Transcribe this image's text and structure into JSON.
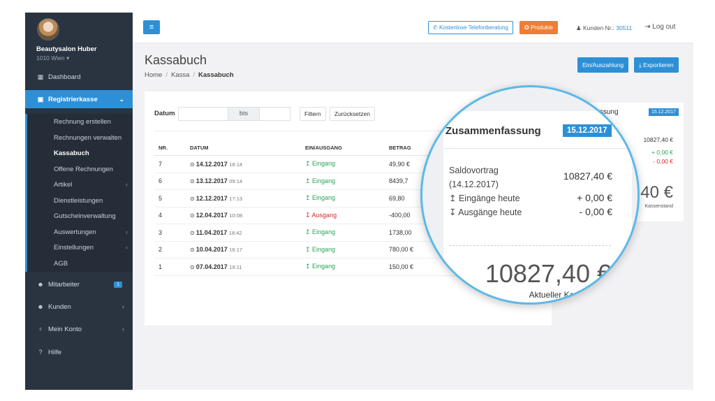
{
  "sidebar": {
    "business_name": "Beautysalon Huber",
    "business_city": "1010 Wien ▾",
    "items": [
      {
        "label": "Dashboard",
        "icon": "grid-icon"
      },
      {
        "label": "Registrierkasse",
        "icon": "cash-register-icon"
      },
      {
        "label": "Mitarbeiter",
        "icon": "users-icon",
        "badge": "1"
      },
      {
        "label": "Kunden",
        "icon": "users-icon"
      },
      {
        "label": "Mein Konto",
        "icon": "bulb-icon"
      },
      {
        "label": "Hilfe",
        "icon": "question-icon"
      }
    ],
    "sub_items": [
      {
        "label": "Rechnung erstellen"
      },
      {
        "label": "Rechnungen verwalten"
      },
      {
        "label": "Kassabuch"
      },
      {
        "label": "Offene Rechnungen"
      },
      {
        "label": "Artikel"
      },
      {
        "label": "Dienstleistungen"
      },
      {
        "label": "Gutscheinverwaltung"
      },
      {
        "label": "Auswertungen"
      },
      {
        "label": "Einstellungen"
      },
      {
        "label": "AGB"
      }
    ]
  },
  "topbar": {
    "menu_icon": "≡",
    "phone_label": "Kostenlose Telefonberatung",
    "products_label": "Produkte",
    "customer_label": "Kunden Nr.:",
    "customer_number": "30511",
    "logout_label": "Log out"
  },
  "page": {
    "title": "Kassabuch",
    "breadcrumb": [
      "Home",
      "Kassa",
      "Kassabuch"
    ],
    "btn_ein_aus": "Ein/Auszahlung",
    "btn_export": "Exportieren"
  },
  "filter": {
    "label": "Datum",
    "bis": "bis",
    "filter_btn": "Filtern",
    "reset_btn": "Zurücksetzen"
  },
  "table": {
    "headers": [
      "NR.",
      "DATUM",
      "EIN/AUSGANG",
      "BETRAG"
    ],
    "rows": [
      {
        "nr": "7",
        "date": "14.12.2017",
        "time": "18:14",
        "type": "Eingang",
        "amount": "49,90 €"
      },
      {
        "nr": "6",
        "date": "13.12.2017",
        "time": "09:14",
        "type": "Eingang",
        "amount": "8439,7"
      },
      {
        "nr": "5",
        "date": "12.12.2017",
        "time": "17:13",
        "type": "Eingang",
        "amount": "69,80"
      },
      {
        "nr": "4",
        "date": "12.04.2017",
        "time": "10:08",
        "type": "Ausgang",
        "amount": "-400,00"
      },
      {
        "nr": "3",
        "date": "11.04.2017",
        "time": "18:42",
        "type": "Eingang",
        "amount": "1738,00"
      },
      {
        "nr": "2",
        "date": "10.04.2017",
        "time": "16:17",
        "type": "Eingang",
        "amount": "780,00 €"
      },
      {
        "nr": "1",
        "date": "07.04.2017",
        "time": "19:11",
        "type": "Eingang",
        "amount": "150,00 €"
      }
    ]
  },
  "summary_small": {
    "title_fragment": "nfassung",
    "date": "15.12.2017",
    "saldo": "10827,40 €",
    "in": "+ 0,00 €",
    "out": "- 0,00 €",
    "total_fragment": ",40 €",
    "label_fragment": "Kassenstand"
  },
  "summary": {
    "title": "Zusammenfassung",
    "date": "15.12.2017",
    "saldo_label": "Saldovortrag",
    "saldo_date": "(14.12.2017)",
    "saldo_value": "10827,40 €",
    "in_label": "Eingänge heute",
    "in_value": "+ 0,00 €",
    "out_label": "Ausgänge heute",
    "out_value": "- 0,00 €",
    "total": "10827,40 €",
    "total_label": "Aktueller Kassenstand"
  },
  "colors": {
    "accent": "#2d90d6",
    "orange": "#ef7e33",
    "green": "#27a35a",
    "red": "#d8262e",
    "sidebar": "#2a3340"
  }
}
